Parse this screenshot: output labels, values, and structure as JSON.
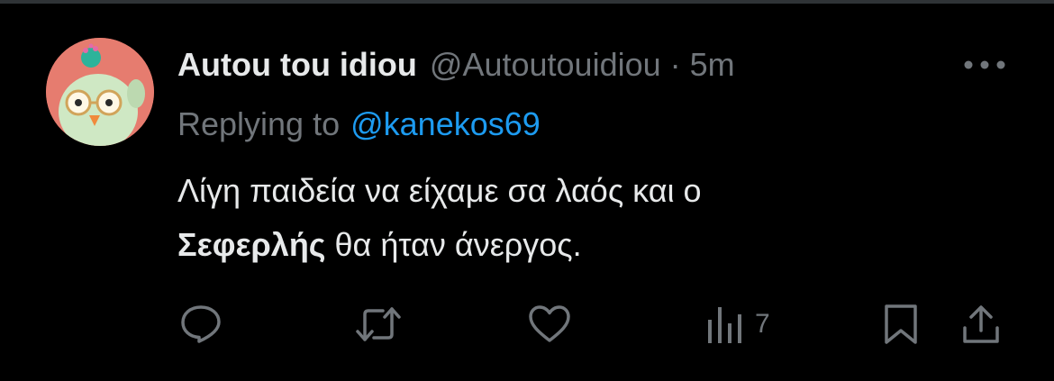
{
  "tweet": {
    "display_name": "Autou tou idiou",
    "handle": "@Autoutouidiou",
    "separator": "·",
    "time": "5m",
    "reply_prefix": "Replying to",
    "reply_target": "@kanekos69",
    "text_line1": "Λίγη παιδεία να είχαμε σα λαός και ο",
    "text_bold": "Σεφερλής",
    "text_line2_rest": " θα ήταν άνεργος.",
    "views": "7"
  },
  "icons": {
    "more": "more-horizontal-icon",
    "reply": "reply-icon",
    "retweet": "retweet-icon",
    "like": "heart-icon",
    "views": "views-analytics-icon",
    "bookmark": "bookmark-icon",
    "share": "share-icon"
  },
  "colors": {
    "background": "#000000",
    "primary_text": "#e7e9ea",
    "secondary_text": "#71767b",
    "link": "#1d9bf0",
    "divider": "#2f3336",
    "avatar_bg": "#e67c6f"
  }
}
